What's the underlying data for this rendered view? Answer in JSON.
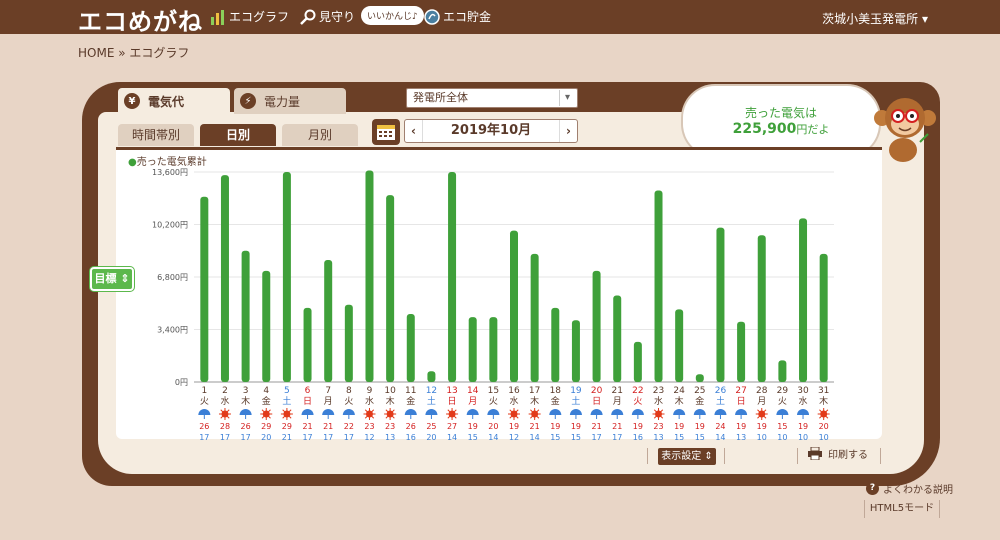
{
  "header": {
    "logo": "エコめがね",
    "nav": [
      {
        "label": "エコグラフ",
        "icon": "bar-chart-icon"
      },
      {
        "label": "見守り",
        "icon": "magnifier-icon"
      },
      {
        "label": "エコ貯金",
        "icon": "coin-icon"
      }
    ],
    "bubble": "いいかんじ♪",
    "plant": "茨城小美玉発電所 ▾"
  },
  "breadcrumb": "HOME » エコグラフ",
  "tabs": {
    "main": [
      {
        "label": "電気代",
        "icon": "yen-icon",
        "glyph": "¥"
      },
      {
        "label": "電力量",
        "icon": "bolt-icon",
        "glyph": "⚡"
      }
    ],
    "sub": [
      "時間帯別",
      "日別",
      "月別"
    ]
  },
  "select": {
    "value": "発電所全体"
  },
  "date": {
    "prev": "‹",
    "label": "2019年10月",
    "next": "›"
  },
  "sold": {
    "line1": "売った電気は",
    "amount": "225,900",
    "suffix": "円だよ"
  },
  "legend": "売った電気累計",
  "goal_button": "目標 ⇕",
  "display_settings": "表示設定 ⇕",
  "print": "印刷する",
  "help": "よくわかる説明",
  "html5": "HTML5モード",
  "colors": {
    "brown": "#6b3f26",
    "green": "#3fa03a",
    "bg": "#e8d5c6",
    "sun": "#e23a1a",
    "blue_day": "#3b7fd6",
    "red_day": "#d42020"
  },
  "chart_data": {
    "type": "bar",
    "y_ticks": [
      "13,600円",
      "10,200円",
      "6,800円",
      "3,400円",
      "0円"
    ],
    "ylim": [
      0,
      13600
    ],
    "categories": [
      "1",
      "2",
      "3",
      "4",
      "5",
      "6",
      "7",
      "8",
      "9",
      "10",
      "11",
      "12",
      "13",
      "14",
      "15",
      "16",
      "17",
      "18",
      "19",
      "20",
      "21",
      "22",
      "23",
      "24",
      "25",
      "26",
      "27",
      "28",
      "29",
      "30",
      "31"
    ],
    "weekdays": [
      "火",
      "水",
      "木",
      "金",
      "土",
      "日",
      "月",
      "火",
      "水",
      "木",
      "金",
      "土",
      "日",
      "月",
      "火",
      "水",
      "木",
      "金",
      "土",
      "日",
      "月",
      "火",
      "水",
      "木",
      "金",
      "土",
      "日",
      "月",
      "火",
      "水",
      "木"
    ],
    "day_color": [
      "n",
      "n",
      "n",
      "n",
      "b",
      "r",
      "n",
      "n",
      "n",
      "n",
      "n",
      "b",
      "r",
      "r",
      "n",
      "n",
      "n",
      "n",
      "b",
      "r",
      "n",
      "r",
      "n",
      "n",
      "n",
      "b",
      "r",
      "n",
      "n",
      "n",
      "n"
    ],
    "weather": [
      "rain",
      "sun",
      "rain",
      "sun",
      "sun",
      "rain",
      "rain",
      "rain",
      "sun",
      "sun",
      "rain",
      "rain",
      "sun",
      "rain",
      "rain",
      "sun",
      "sun",
      "rain",
      "rain",
      "rain",
      "rain",
      "rain",
      "sun",
      "rain",
      "rain",
      "rain",
      "rain",
      "sun",
      "rain",
      "rain",
      "sun"
    ],
    "high": [
      26,
      28,
      26,
      29,
      29,
      21,
      21,
      22,
      23,
      23,
      26,
      25,
      27,
      19,
      20,
      19,
      21,
      19,
      19,
      21,
      21,
      19,
      23,
      19,
      19,
      24,
      19,
      19,
      15,
      19,
      20
    ],
    "low": [
      17,
      17,
      17,
      20,
      21,
      17,
      17,
      17,
      12,
      13,
      16,
      20,
      14,
      15,
      14,
      12,
      14,
      15,
      15,
      17,
      17,
      16,
      13,
      15,
      15,
      14,
      13,
      10,
      10,
      10,
      10
    ],
    "values": [
      12000,
      13400,
      8500,
      7200,
      13600,
      4800,
      7900,
      5000,
      13700,
      12100,
      4400,
      700,
      13600,
      4200,
      4200,
      9800,
      8300,
      4800,
      4000,
      7200,
      5600,
      2600,
      12400,
      4700,
      500,
      10000,
      3900,
      9500,
      1400,
      10600,
      8300
    ],
    "series": [
      {
        "name": "売った電気累計",
        "values": [
          12000,
          13400,
          8500,
          7200,
          13600,
          4800,
          7900,
          5000,
          13700,
          12100,
          4400,
          700,
          13600,
          4200,
          4200,
          9800,
          8300,
          4800,
          4000,
          7200,
          5600,
          2600,
          12400,
          4700,
          500,
          10000,
          3900,
          9500,
          1400,
          10600,
          8300
        ]
      }
    ]
  }
}
